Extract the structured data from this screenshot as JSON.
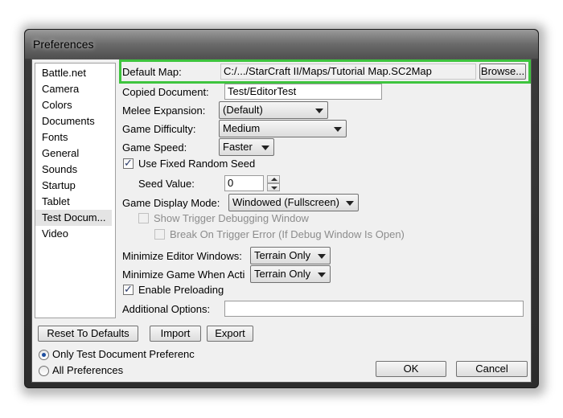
{
  "window": {
    "title": "Preferences"
  },
  "sidebar": {
    "items": [
      {
        "label": "Battle.net"
      },
      {
        "label": "Camera"
      },
      {
        "label": "Colors"
      },
      {
        "label": "Documents"
      },
      {
        "label": "Fonts"
      },
      {
        "label": "General"
      },
      {
        "label": "Sounds"
      },
      {
        "label": "Startup"
      },
      {
        "label": "Tablet"
      },
      {
        "label": "Test Docum..."
      },
      {
        "label": "Video"
      }
    ],
    "selected": "Test Docum..."
  },
  "settings": {
    "default_map": {
      "label": "Default Map:",
      "value": "C:/.../StarCraft II/Maps/Tutorial Map.SC2Map",
      "browse_label": "Browse..."
    },
    "copied_document": {
      "label": "Copied Document:",
      "value": "Test/EditorTest"
    },
    "melee_expansion": {
      "label": "Melee Expansion:",
      "value": "(Default)"
    },
    "game_difficulty": {
      "label": "Game Difficulty:",
      "value": "Medium"
    },
    "game_speed": {
      "label": "Game Speed:",
      "value": "Faster"
    },
    "use_fixed_seed": {
      "label": "Use Fixed Random Seed",
      "checked": true
    },
    "seed_value": {
      "label": "Seed Value:",
      "value": "0"
    },
    "game_display_mode": {
      "label": "Game Display Mode:",
      "value": "Windowed (Fullscreen)"
    },
    "show_trigger_debugging": {
      "label": "Show Trigger Debugging Window",
      "checked": false,
      "enabled": false
    },
    "break_on_trigger_error": {
      "label": "Break On Trigger Error (If Debug Window Is Open)",
      "checked": false,
      "enabled": false
    },
    "minimize_editor_windows": {
      "label": "Minimize Editor Windows:",
      "value": "Terrain Only"
    },
    "minimize_game_when_active": {
      "label": "Minimize Game When Acti",
      "value": "Terrain Only"
    },
    "enable_preloading": {
      "label": "Enable Preloading",
      "checked": true
    },
    "additional_options": {
      "label": "Additional Options:",
      "value": ""
    }
  },
  "footer": {
    "reset_label": "Reset To Defaults",
    "import_label": "Import",
    "export_label": "Export",
    "scope_options": [
      {
        "label": "Only Test Document Preferenc",
        "selected": true
      },
      {
        "label": "All Preferences",
        "selected": false
      }
    ],
    "ok_label": "OK",
    "cancel_label": "Cancel"
  },
  "colors": {
    "highlight": "#3ec43e",
    "title_bar": "#5a5a5a",
    "dialog_bg": "#f0f0f0"
  }
}
